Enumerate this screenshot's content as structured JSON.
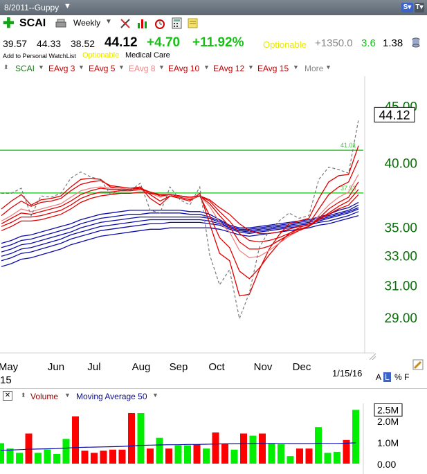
{
  "window": {
    "title": "8/2011--Guppy"
  },
  "header": {
    "symbol": "SCAI",
    "period": "Weekly",
    "open": "39.57",
    "high": "44.33",
    "low": "38.52",
    "last": "44.12",
    "change": "+4.70",
    "change_pct": "+11.92%",
    "optionable": "Optionable",
    "extra_value": "+1350.0",
    "extra_green": "3.6",
    "extra_black": "1.38",
    "watchlist": "Add to Personal WatchList",
    "optionable_small": "Optionable",
    "sector": "Medical Care"
  },
  "indicators": {
    "scai": "SCAI",
    "eavg3": "EAvg 3",
    "eavg5": "EAvg 5",
    "eavg8": "EAvg 8",
    "eavg10": "EAvg 10",
    "eavg12": "EAvg 12",
    "eavg15": "EAvg 15",
    "more": "More"
  },
  "volume_panel": {
    "volume_label": "Volume",
    "ma_label": "Moving Average 50",
    "last_volume": "2.5M",
    "y_ticks": [
      "2.0M",
      "1.0M",
      "0.00"
    ]
  },
  "footer": {
    "date": "1/15/16",
    "mode_a": "A",
    "mode_l": "L",
    "mode_pct": "%",
    "mode_f": "F",
    "x_first_sub": "15"
  },
  "colors": {
    "up": "#00ee00",
    "down": "#ff0000",
    "short_ema": "#e00000",
    "long_ema": "#0b0ba8",
    "hline": "#33cc33",
    "axis_green": "#0a6e0a"
  },
  "chart_data": [
    {
      "type": "line",
      "title": "",
      "y_scale": "log",
      "ylim": [
        27.7,
        47.5
      ],
      "y_ticks": [
        29,
        31,
        33,
        35,
        40,
        45
      ],
      "y_tick_labels": [
        "29.00",
        "31.00",
        "33.00",
        "35.00",
        "40.00",
        "45.00"
      ],
      "last_price_label": "44.12",
      "x_labels": [
        "May",
        "Jun",
        "Jul",
        "Aug",
        "Sep",
        "Oct",
        "Nov",
        "Dec"
      ],
      "horizontal_lines": [
        {
          "value": 41.01,
          "label": "41.01"
        },
        {
          "value": 37.53,
          "label": "37.53"
        }
      ],
      "series": [
        {
          "name": "SCAI",
          "style": "dashed",
          "values": [
            37.5,
            37.5,
            37.9,
            35.8,
            37.3,
            37.2,
            37.5,
            38.7,
            39.2,
            38.8,
            38.6,
            37.4,
            37.8,
            37.7,
            38.3,
            36.2,
            36.0,
            38.0,
            37.0,
            36.6,
            38.0,
            33.0,
            31.0,
            32.0,
            28.9,
            30.5,
            33.5,
            34.7,
            35.4,
            36.0,
            35.6,
            35.8,
            38.6,
            39.6,
            39.4,
            39.1,
            43.7
          ]
        },
        {
          "name": "EAvg 3",
          "values": [
            36.3,
            36.9,
            37.4,
            36.6,
            37.0,
            37.1,
            37.3,
            38.0,
            38.6,
            38.7,
            38.6,
            38.0,
            37.9,
            37.8,
            38.0,
            37.1,
            36.6,
            37.3,
            37.1,
            36.9,
            37.5,
            35.2,
            33.1,
            32.6,
            30.3,
            30.4,
            32.0,
            33.4,
            34.4,
            35.2,
            35.4,
            35.6,
            37.1,
            38.4,
            38.9,
            39.0,
            41.4
          ]
        },
        {
          "name": "EAvg 5",
          "values": [
            35.8,
            36.4,
            36.9,
            36.5,
            36.8,
            36.9,
            37.1,
            37.7,
            38.2,
            38.4,
            38.5,
            38.1,
            38.0,
            37.9,
            38.0,
            37.4,
            36.9,
            37.3,
            37.2,
            37.0,
            37.3,
            35.8,
            34.2,
            33.5,
            31.9,
            31.4,
            32.1,
            33.0,
            33.8,
            34.5,
            34.9,
            35.2,
            36.3,
            37.4,
            38.0,
            38.4,
            40.2
          ]
        },
        {
          "name": "EAvg 8",
          "values": [
            35.4,
            35.8,
            36.3,
            36.1,
            36.3,
            36.5,
            36.7,
            37.2,
            37.7,
            37.9,
            38.0,
            37.9,
            37.9,
            37.8,
            37.9,
            37.5,
            37.2,
            37.4,
            37.3,
            37.1,
            37.3,
            36.5,
            35.3,
            34.6,
            33.3,
            32.8,
            32.9,
            33.3,
            33.8,
            34.3,
            34.7,
            35.0,
            35.8,
            36.6,
            37.2,
            37.6,
            39.0
          ]
        },
        {
          "name": "EAvg 10",
          "values": [
            35.2,
            35.6,
            36.0,
            35.9,
            36.1,
            36.3,
            36.5,
            36.9,
            37.4,
            37.7,
            37.9,
            37.8,
            37.8,
            37.8,
            37.9,
            37.6,
            37.3,
            37.4,
            37.3,
            37.2,
            37.3,
            36.7,
            35.8,
            35.0,
            33.9,
            33.4,
            33.4,
            33.6,
            34.0,
            34.4,
            34.7,
            35.0,
            35.6,
            36.3,
            36.8,
            37.2,
            38.4
          ]
        },
        {
          "name": "EAvg 12",
          "values": [
            35.0,
            35.3,
            35.7,
            35.7,
            35.8,
            36.0,
            36.2,
            36.6,
            37.1,
            37.4,
            37.6,
            37.6,
            37.7,
            37.7,
            37.8,
            37.6,
            37.4,
            37.4,
            37.3,
            37.2,
            37.3,
            36.9,
            36.1,
            35.4,
            34.5,
            34.0,
            33.9,
            34.0,
            34.2,
            34.5,
            34.8,
            35.0,
            35.5,
            36.0,
            36.5,
            36.9,
            37.8
          ]
        },
        {
          "name": "EAvg 15",
          "values": [
            34.7,
            35.0,
            35.4,
            35.4,
            35.5,
            35.7,
            35.9,
            36.3,
            36.8,
            37.1,
            37.3,
            37.4,
            37.5,
            37.5,
            37.6,
            37.5,
            37.4,
            37.4,
            37.3,
            37.2,
            37.3,
            37.0,
            36.4,
            35.9,
            35.2,
            34.7,
            34.5,
            34.5,
            34.6,
            34.8,
            35.0,
            35.1,
            35.5,
            35.9,
            36.3,
            36.6,
            37.4
          ]
        },
        {
          "name": "EAvg 30",
          "values": [
            33.8,
            34.0,
            34.3,
            34.4,
            34.6,
            34.8,
            35.0,
            35.2,
            35.5,
            35.7,
            35.9,
            36.0,
            36.1,
            36.2,
            36.2,
            36.2,
            36.2,
            36.2,
            36.2,
            36.1,
            36.1,
            35.9,
            35.5,
            35.1,
            34.9,
            34.9,
            35.0,
            35.1,
            35.2,
            35.3,
            35.4,
            35.5,
            35.7,
            35.9,
            36.2,
            36.4,
            36.8
          ]
        },
        {
          "name": "EAvg 35",
          "values": [
            33.5,
            33.7,
            34.0,
            34.1,
            34.3,
            34.5,
            34.7,
            34.9,
            35.2,
            35.4,
            35.6,
            35.7,
            35.8,
            35.9,
            35.9,
            36.0,
            36.0,
            36.0,
            36.0,
            35.9,
            35.9,
            35.7,
            35.4,
            35.0,
            34.8,
            34.8,
            34.9,
            35.0,
            35.1,
            35.2,
            35.3,
            35.4,
            35.6,
            35.8,
            36.0,
            36.2,
            36.6
          ]
        },
        {
          "name": "EAvg 40",
          "values": [
            33.2,
            33.4,
            33.7,
            33.8,
            34.0,
            34.2,
            34.4,
            34.6,
            34.9,
            35.1,
            35.3,
            35.4,
            35.5,
            35.6,
            35.7,
            35.7,
            35.7,
            35.7,
            35.7,
            35.7,
            35.7,
            35.6,
            35.3,
            34.9,
            34.7,
            34.7,
            34.8,
            34.9,
            35.0,
            35.1,
            35.2,
            35.3,
            35.5,
            35.7,
            35.9,
            36.1,
            36.4
          ]
        },
        {
          "name": "EAvg 45",
          "values": [
            32.9,
            33.1,
            33.4,
            33.5,
            33.7,
            33.9,
            34.1,
            34.4,
            34.6,
            34.8,
            35.0,
            35.1,
            35.2,
            35.3,
            35.4,
            35.5,
            35.5,
            35.5,
            35.5,
            35.5,
            35.5,
            35.4,
            35.2,
            34.9,
            34.7,
            34.6,
            34.7,
            34.8,
            34.9,
            35.0,
            35.1,
            35.2,
            35.4,
            35.6,
            35.8,
            36.0,
            36.3
          ]
        },
        {
          "name": "EAvg 50",
          "values": [
            32.6,
            32.8,
            33.1,
            33.2,
            33.4,
            33.6,
            33.8,
            34.1,
            34.3,
            34.5,
            34.7,
            34.8,
            34.9,
            35.0,
            35.1,
            35.2,
            35.2,
            35.3,
            35.3,
            35.3,
            35.3,
            35.2,
            35.1,
            34.8,
            34.6,
            34.5,
            34.6,
            34.7,
            34.8,
            34.9,
            35.0,
            35.1,
            35.3,
            35.4,
            35.6,
            35.8,
            36.1
          ]
        },
        {
          "name": "EAvg 60",
          "values": [
            32.2,
            32.4,
            32.7,
            32.8,
            33.0,
            33.2,
            33.4,
            33.7,
            33.9,
            34.1,
            34.3,
            34.4,
            34.5,
            34.6,
            34.7,
            34.8,
            34.8,
            34.9,
            34.9,
            34.9,
            34.9,
            34.9,
            34.8,
            34.6,
            34.4,
            34.3,
            34.4,
            34.5,
            34.6,
            34.7,
            34.8,
            34.9,
            35.1,
            35.2,
            35.4,
            35.6,
            35.8
          ]
        }
      ]
    },
    {
      "type": "bar",
      "title": "",
      "ylim": [
        0,
        2.8
      ],
      "y_unit": "M",
      "values": [
        0.95,
        0.7,
        0.5,
        1.4,
        0.5,
        0.65,
        0.45,
        1.15,
        2.2,
        0.6,
        0.5,
        0.6,
        0.65,
        0.65,
        2.35,
        2.35,
        0.7,
        1.2,
        0.7,
        0.85,
        0.85,
        0.9,
        0.7,
        1.45,
        0.9,
        0.65,
        1.4,
        1.3,
        1.4,
        0.95,
        0.9,
        0.35,
        0.7,
        0.7,
        1.7,
        0.5,
        0.55,
        1.1,
        2.5
      ],
      "colors": [
        "G",
        "G",
        "G",
        "R",
        "G",
        "G",
        "G",
        "G",
        "R",
        "R",
        "R",
        "R",
        "R",
        "R",
        "R",
        "G",
        "R",
        "G",
        "R",
        "G",
        "G",
        "R",
        "G",
        "R",
        "R",
        "G",
        "R",
        "G",
        "R",
        "G",
        "G",
        "G",
        "R",
        "R",
        "G",
        "G",
        "G",
        "R",
        "G"
      ],
      "moving_average": {
        "name": "Moving Average 50",
        "values": [
          0.62,
          0.63,
          0.65,
          0.67,
          0.68,
          0.69,
          0.7,
          0.72,
          0.75,
          0.76,
          0.77,
          0.78,
          0.79,
          0.8,
          0.82,
          0.85,
          0.86,
          0.87,
          0.88,
          0.88,
          0.89,
          0.89,
          0.9,
          0.91,
          0.92,
          0.92,
          0.93,
          0.93,
          0.94,
          0.94,
          0.94,
          0.93,
          0.93,
          0.93,
          0.94,
          0.94,
          0.94,
          0.95,
          0.97
        ]
      }
    }
  ]
}
